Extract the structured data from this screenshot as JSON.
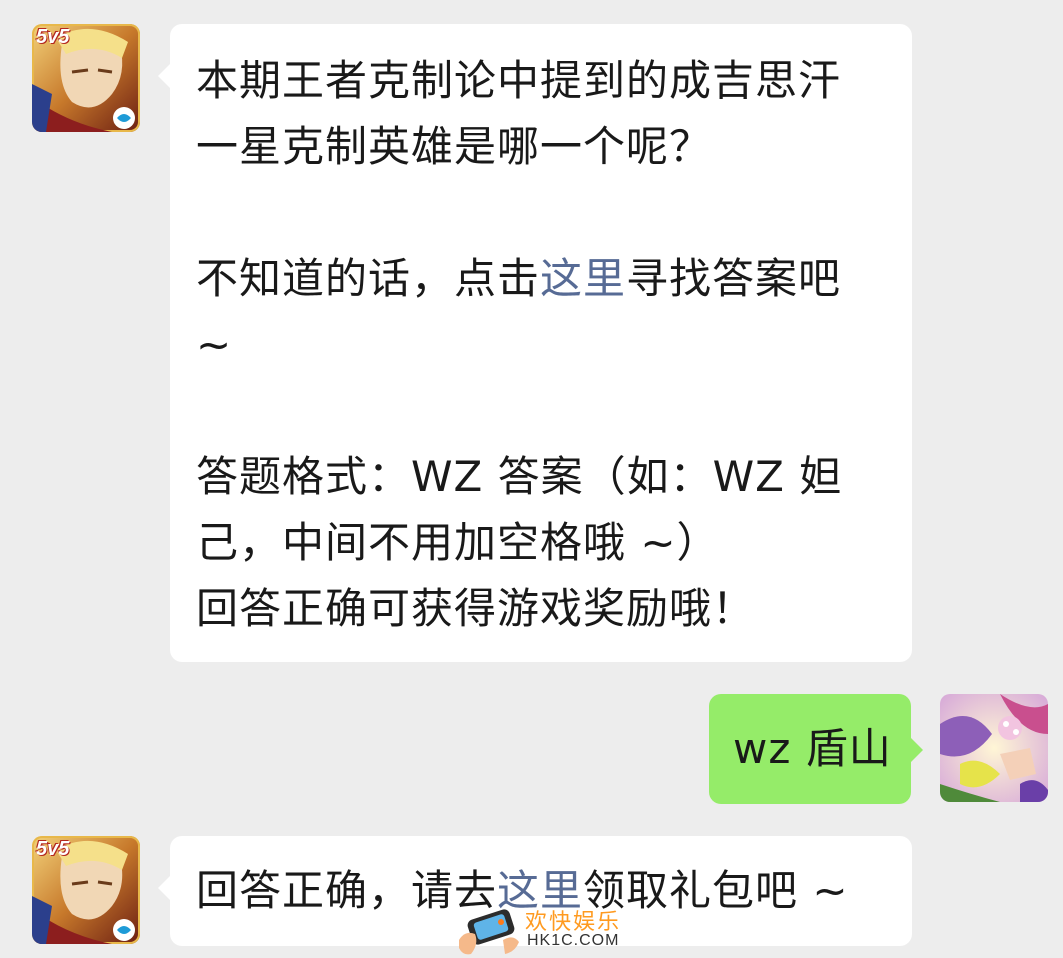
{
  "messages": [
    {
      "sender": "official",
      "lines": [
        "本期王者克制论中提到的成吉思汗",
        "一星克制英雄是哪一个呢？"
      ],
      "hint_before": "不知道的话，点击",
      "hint_link": "这里",
      "hint_after": "寻找答案吧",
      "hint_tail": "~",
      "format_line1": "答题格式：WZ 答案（如：WZ 妲",
      "format_line2": "己，中间不用加空格哦 ~）",
      "reward_line": "回答正确可获得游戏奖励哦！"
    },
    {
      "sender": "user",
      "text": "wz 盾山"
    },
    {
      "sender": "official",
      "before": "回答正确，请去",
      "link": "这里",
      "after": "领取礼包吧 ~"
    }
  ],
  "avatar_badge": "5v5",
  "watermark": {
    "cn": "欢快娱乐",
    "en": "HK1C.COM"
  }
}
